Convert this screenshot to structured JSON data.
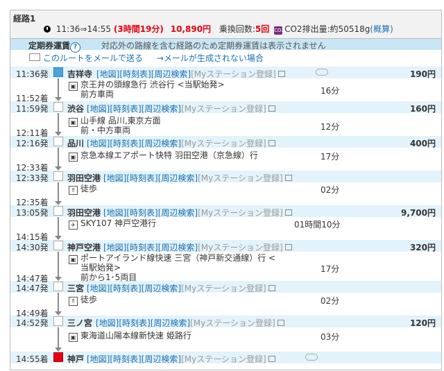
{
  "route": {
    "title": "経路1",
    "times": "11:36⇒14:55",
    "duration": "(3時間19分)",
    "fare": "10,890円",
    "transfer_label": "乗換回数:",
    "transfer_count": "5回",
    "co2_label": "CO2排出量:約50518g",
    "co2_link": "(概算)"
  },
  "teiki": {
    "label": "定期券運賃",
    "help": "?",
    "message": "対応外の路線を含む経路のため定期券運賃は表示されません"
  },
  "mail": {
    "send_link": "このルートをメールで送る",
    "trouble_link": "→メールが生成されない場合"
  },
  "links": {
    "map": "[地図]",
    "timetable": "[時刻表]",
    "nearby": "[周辺検索]",
    "mystation": "[Myステーション登録]"
  },
  "stations": [
    {
      "time": "11:36発",
      "name": "吉祥寺",
      "fare": "190円"
    },
    {
      "arr": "11:52着",
      "time": "11:59発",
      "name": "渋谷",
      "fare": "160円"
    },
    {
      "arr": "12:11着",
      "time": "12:16発",
      "name": "品川",
      "fare": "400円"
    },
    {
      "arr": "12:33着",
      "time": "12:33発",
      "name": "羽田空港",
      "fare": ""
    },
    {
      "arr": "12:35着",
      "time": "13:05発",
      "name": "羽田空港",
      "fare": "9,700円"
    },
    {
      "arr": "14:15着",
      "time": "14:30発",
      "name": "神戸空港",
      "fare": "320円"
    },
    {
      "arr": "14:47着",
      "time": "14:47発",
      "name": "三宮",
      "fare": ""
    },
    {
      "arr": "14:49着",
      "time": "14:52発",
      "name": "三ノ宮",
      "fare": "120円"
    },
    {
      "arr": "",
      "time": "14:55着",
      "name": "神戸",
      "fare": ""
    }
  ],
  "segments": [
    {
      "icon": "train",
      "lines": [
        "京王井の頭線急行 渋谷行 <当駅始発>",
        "前方車両"
      ],
      "duration": "16分"
    },
    {
      "icon": "train",
      "lines": [
        "山手線 品川,東京方面",
        "前・中方車両"
      ],
      "duration": "12分"
    },
    {
      "icon": "train",
      "lines": [
        "京急本線エアポート快特 羽田空港（京急線）行"
      ],
      "duration": "17分"
    },
    {
      "icon": "walk",
      "lines": [
        "徒歩"
      ],
      "duration": "02分"
    },
    {
      "icon": "plane",
      "lines": [
        "SKY107 神戸空港行"
      ],
      "duration": "01時間10分"
    },
    {
      "icon": "train",
      "lines": [
        "ポートアイランド線快速 三宮（神戸新交通線）行 <",
        "当駅始発>",
        "前から1･5両目"
      ],
      "duration": "17分"
    },
    {
      "icon": "walk",
      "lines": [
        "徒歩"
      ],
      "duration": "02分"
    },
    {
      "icon": "train",
      "lines": [
        "東海道山陽本線新快速 姫路行"
      ],
      "duration": "03分"
    }
  ]
}
